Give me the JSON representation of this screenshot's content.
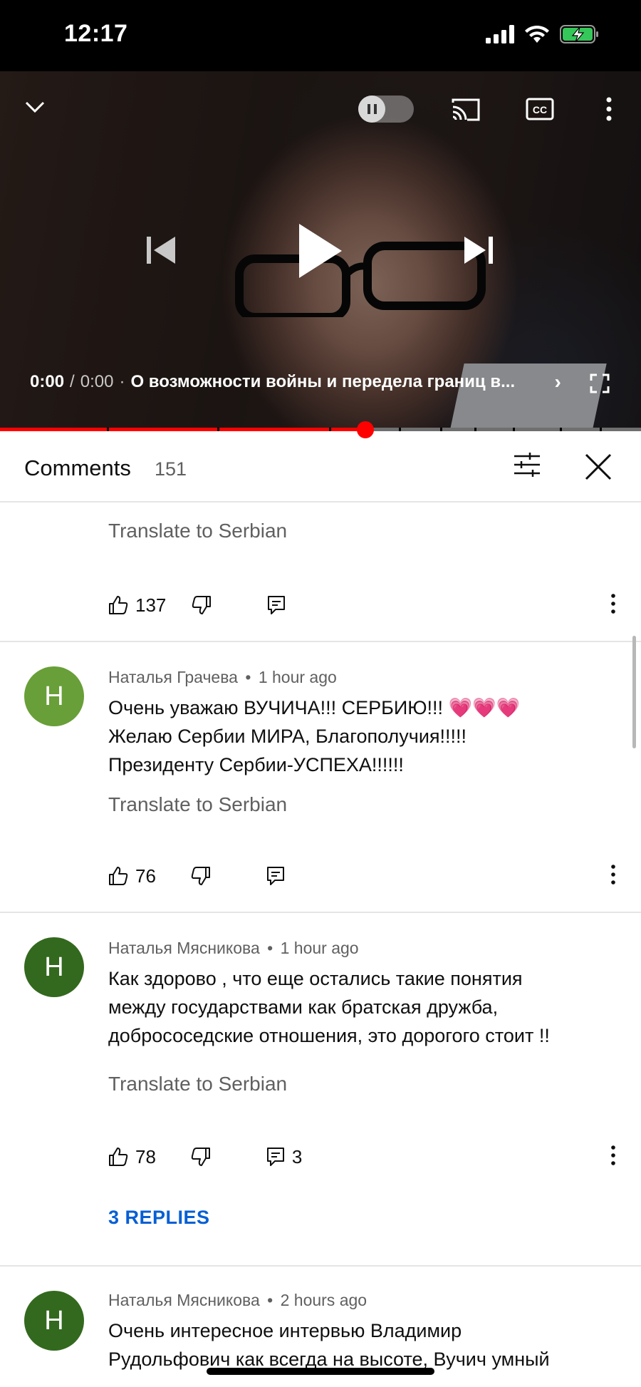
{
  "status": {
    "time": "12:17"
  },
  "player": {
    "current_time": "0:00",
    "separator": "/",
    "duration": "0:00",
    "dot": "·",
    "title": "О возможности войны и передела границ в...",
    "progress_fraction": 0.57
  },
  "comments_header": {
    "title": "Comments",
    "count": "151"
  },
  "comments": [
    {
      "translate": "Translate to Serbian",
      "likes": "137"
    },
    {
      "avatar_letter": "Н",
      "author": "Наталья Грачева",
      "time": "1 hour ago",
      "text_line1": "Очень уважаю ВУЧИЧА!!! СЕРБИЮ!!!",
      "text_line2": "Желаю Сербии МИРА, Благополучия!!!!!",
      "text_line3": "Президенту Сербии-УСПЕХА!!!!!!",
      "emoji": [
        "💗",
        "💗",
        "💗"
      ],
      "translate": "Translate to Serbian",
      "likes": "76",
      "avatar_color": "#689f38"
    },
    {
      "avatar_letter": "Н",
      "author": "Наталья Мясникова",
      "time": "1 hour ago",
      "text_line1": "Как здорово , что еще остались такие понятия",
      "text_line2": "между государствами как братская дружба,",
      "text_line3": "добрососедские отношения, это дорогого стоит !!",
      "translate": "Translate to Serbian",
      "likes": "78",
      "reply_count": "3",
      "replies_label": "3 REPLIES",
      "avatar_color": "#33691e"
    },
    {
      "avatar_letter": "Н",
      "author": "Наталья Мясникова",
      "time": "2 hours ago",
      "text_line1": "Очень интересное интервью  Владимир",
      "text_line2": "Рудольфович как всегда на высоте, Вучич умный",
      "avatar_color": "#33691e"
    }
  ],
  "meta_separator": "•",
  "colors": {
    "red": "#ff0000",
    "link_blue": "#065fd4",
    "muted": "#606060"
  }
}
